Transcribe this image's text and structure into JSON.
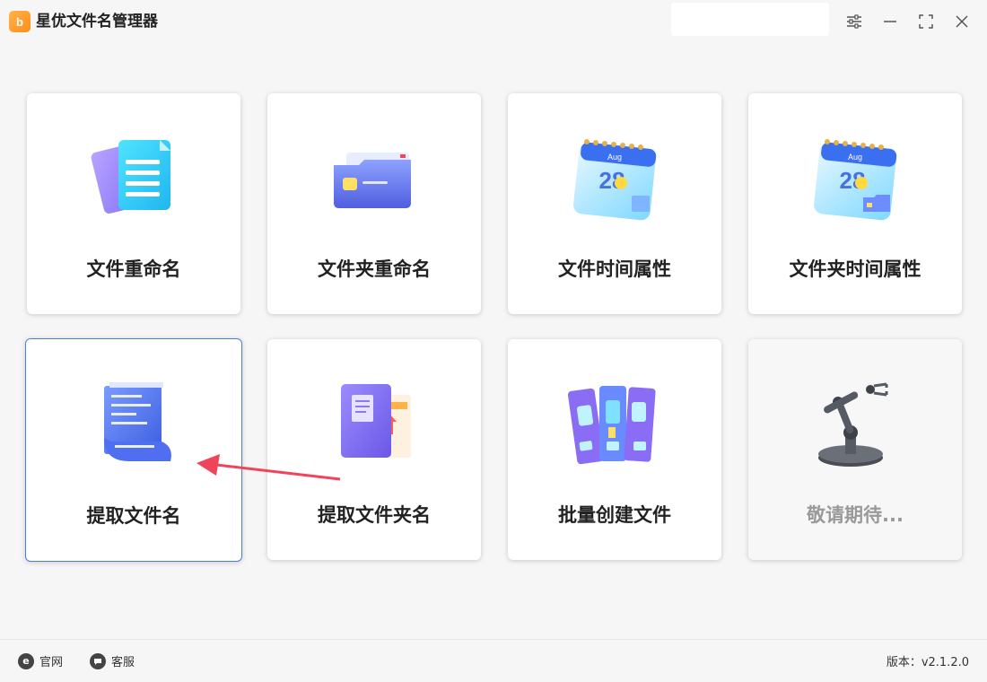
{
  "app": {
    "title": "星优文件名管理器",
    "logo_text": "b"
  },
  "window_controls": {
    "settings_icon": "sliders-icon",
    "minimize_icon": "minimize-icon",
    "maximize_icon": "maximize-icon",
    "close_icon": "close-icon"
  },
  "cards": [
    {
      "label": "文件重命名",
      "icon": "documents-icon"
    },
    {
      "label": "文件夹重命名",
      "icon": "folder-icon"
    },
    {
      "label": "文件时间属性",
      "icon": "calendar-icon",
      "calendar_month": "Aug",
      "calendar_day": "28"
    },
    {
      "label": "文件夹时间属性",
      "icon": "calendar-folder-icon",
      "calendar_month": "Aug",
      "calendar_day": "28"
    },
    {
      "label": "提取文件名",
      "icon": "scroll-document-icon"
    },
    {
      "label": "提取文件夹名",
      "icon": "folder-extract-icon"
    },
    {
      "label": "批量创建文件",
      "icon": "binders-icon"
    },
    {
      "label": "敬请期待...",
      "icon": "robot-arm-icon"
    }
  ],
  "footer": {
    "website_label": "官网",
    "website_icon_text": "e",
    "support_label": "客服",
    "version_text": "版本：v2.1.2.0"
  },
  "colors": {
    "accent": "#4a7fe0",
    "arrow": "#f0445a",
    "logo": "#ff9a2a"
  }
}
